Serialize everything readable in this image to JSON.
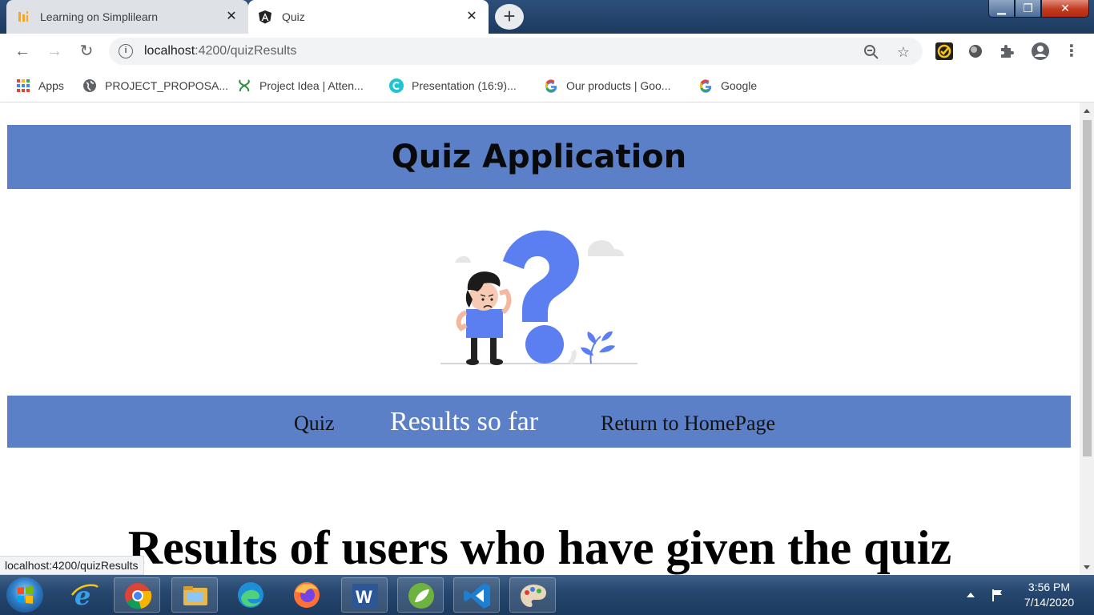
{
  "browser": {
    "tabs": [
      {
        "title": "Learning on Simplilearn",
        "active": false,
        "icon": "simplilearn-icon"
      },
      {
        "title": "Quiz",
        "active": true,
        "icon": "angular-icon"
      }
    ],
    "new_tab": "+",
    "address": {
      "host": "localhost",
      "path": ":4200/quizResults"
    },
    "bookmarks": [
      {
        "label": "Apps",
        "icon": "apps-grid-icon"
      },
      {
        "label": "PROJECT_PROPOSA...",
        "icon": "globe-icon"
      },
      {
        "label": "Project Idea | Atten...",
        "icon": "hackerearth-icon"
      },
      {
        "label": "Presentation (16:9)...",
        "icon": "canva-icon"
      },
      {
        "label": "Our products | Goo...",
        "icon": "google-icon"
      },
      {
        "label": "Google",
        "icon": "google-icon"
      }
    ]
  },
  "page": {
    "header_title": "Quiz Application",
    "nav": {
      "quiz": "Quiz",
      "results": "Results so far",
      "home": "Return to HomePage"
    },
    "results_title": "Results of users who have given the quiz"
  },
  "status_url": "localhost:4200/quizResults",
  "taskbar": {
    "apps": [
      "internet-explorer-icon",
      "chrome-icon",
      "file-explorer-icon",
      "edge-icon",
      "firefox-icon",
      "word-icon",
      "spring-tool-suite-icon",
      "vscode-icon",
      "paint-icon"
    ],
    "time": "3:56 PM",
    "date": "7/14/2020"
  },
  "colors": {
    "banner": "#5b80c7",
    "nav_active_link": "#ffffff"
  }
}
